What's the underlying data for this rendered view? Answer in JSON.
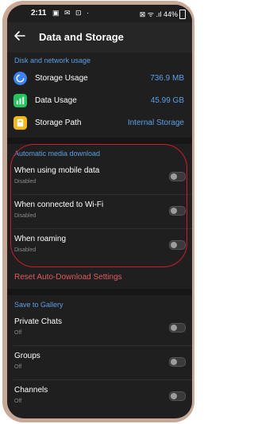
{
  "status_bar": {
    "time": "2:11",
    "notification_icons": "▣ ✉ ⊡ ·",
    "right_text": "⊠ ᯤ .ıl 44%"
  },
  "header": {
    "title": "Data and Storage",
    "back_icon": "arrow-left-icon"
  },
  "disk_section": {
    "heading": "Disk and network usage",
    "items": [
      {
        "label": "Storage Usage",
        "value": "736.9 MB",
        "icon": "storage-usage-icon",
        "color": "#3b82f6"
      },
      {
        "label": "Data Usage",
        "value": "45.99 GB",
        "icon": "data-usage-icon",
        "color": "#22c55e"
      },
      {
        "label": "Storage Path",
        "value": "Internal Storage",
        "icon": "storage-path-icon",
        "color": "#f5b811"
      }
    ]
  },
  "auto_download": {
    "heading": "Automatic media download",
    "items": [
      {
        "label": "When using mobile data",
        "status": "Disabled",
        "enabled": false
      },
      {
        "label": "When connected to Wi-Fi",
        "status": "Disabled",
        "enabled": false
      },
      {
        "label": "When roaming",
        "status": "Disabled",
        "enabled": false
      }
    ],
    "reset_label": "Reset Auto-Download Settings"
  },
  "gallery": {
    "heading": "Save to Gallery",
    "items": [
      {
        "label": "Private Chats",
        "status": "Off",
        "enabled": false
      },
      {
        "label": "Groups",
        "status": "Off",
        "enabled": false
      },
      {
        "label": "Channels",
        "status": "Off",
        "enabled": false
      }
    ]
  },
  "colors": {
    "accent": "#5aa0e6",
    "reset": "#e05b5b",
    "annotation": "#d01c2a",
    "background": "#1f1f1f"
  }
}
